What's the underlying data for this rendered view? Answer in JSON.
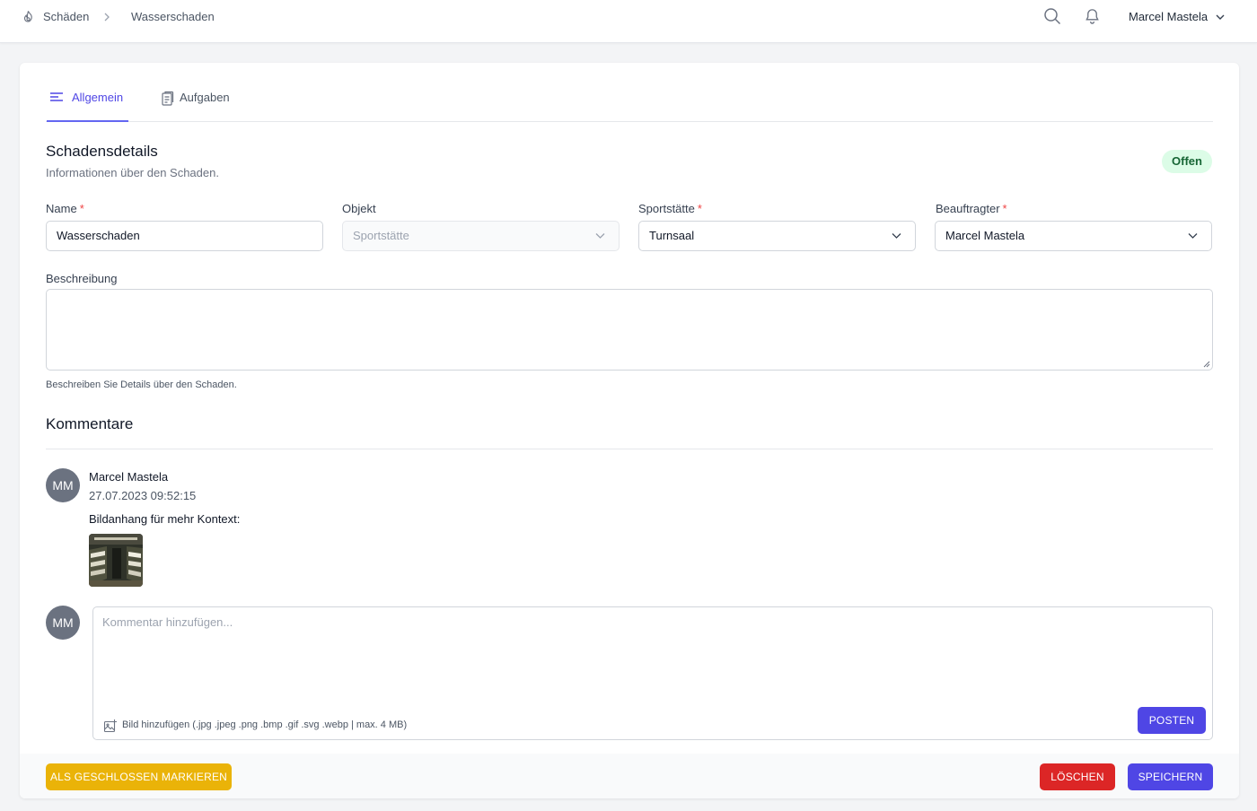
{
  "breadcrumb": {
    "root": "Schäden",
    "current": "Wasserschaden"
  },
  "header": {
    "user_name": "Marcel Mastela"
  },
  "tabs": [
    {
      "label": "Allgemein",
      "active": true
    },
    {
      "label": "Aufgaben",
      "active": false
    }
  ],
  "section": {
    "title": "Schadensdetails",
    "subtitle": "Informationen über den Schaden.",
    "status": "Offen"
  },
  "form": {
    "name": {
      "label": "Name",
      "required_mark": "*",
      "value": "Wasserschaden"
    },
    "object": {
      "label": "Objekt",
      "placeholder": "Sportstätte"
    },
    "venue": {
      "label": "Sportstätte",
      "required_mark": "*",
      "value": "Turnsaal"
    },
    "assignee": {
      "label": "Beauftragter",
      "required_mark": "*",
      "value": "Marcel Mastela"
    },
    "description": {
      "label": "Beschreibung",
      "value": "",
      "help": "Beschreiben Sie Details über den Schaden."
    }
  },
  "comments": {
    "title": "Kommentare",
    "items": [
      {
        "initials": "MM",
        "author": "Marcel Mastela",
        "timestamp": "27.07.2023 09:52:15",
        "text": "Bildanhang für mehr Kontext:"
      }
    ],
    "new": {
      "initials": "MM",
      "placeholder": "Kommentar hinzufügen...",
      "attach_label": "Bild hinzufügen (.jpg .jpeg .png .bmp .gif .svg .webp | max. 4 MB)",
      "post_label": "POSTEN"
    }
  },
  "footer": {
    "close_label": "ALS GESCHLOSSEN MARKIEREN",
    "delete_label": "LÖSCHEN",
    "save_label": "SPEICHERN"
  },
  "colors": {
    "primary": "#4f46e5",
    "danger": "#dc2626",
    "warning": "#eab308",
    "status_bg": "#dcfce7",
    "status_text": "#166534"
  }
}
